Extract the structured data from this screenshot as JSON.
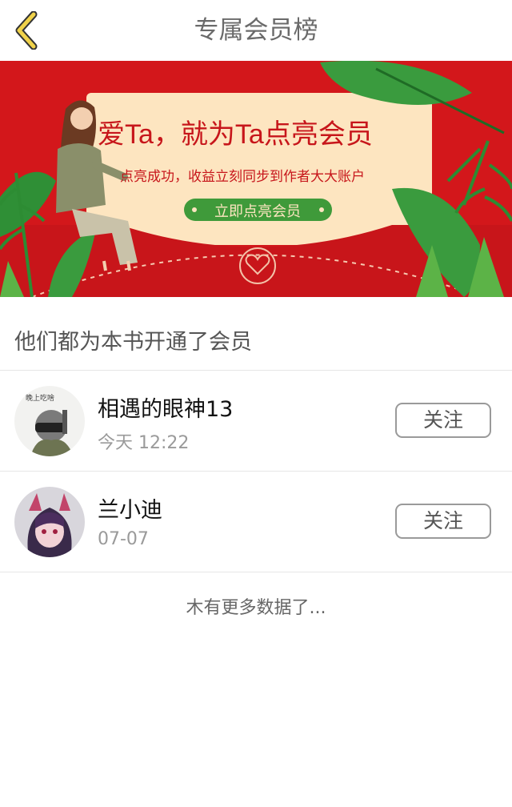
{
  "header": {
    "title": "专属会员榜",
    "back_icon": "chevron-left-icon",
    "accent": "#f0d24a"
  },
  "banner": {
    "headline": "爱Ta，就为Ta点亮会员",
    "subline": "点亮成功，收益立刻同步到作者大大账户",
    "cta": "立即点亮会员",
    "background": "#d3171b",
    "card": "#fde5c0",
    "cta_color": "#3f9a3a"
  },
  "section": {
    "title": "他们都为本书开通了会员"
  },
  "members": [
    {
      "name": "相遇的眼神13",
      "time": "今天 12:22",
      "follow": "关注",
      "avatar_text": "晚上吃啥"
    },
    {
      "name": "兰小迪",
      "time": "07-07",
      "follow": "关注"
    }
  ],
  "footer": {
    "note": "木有更多数据了..."
  }
}
